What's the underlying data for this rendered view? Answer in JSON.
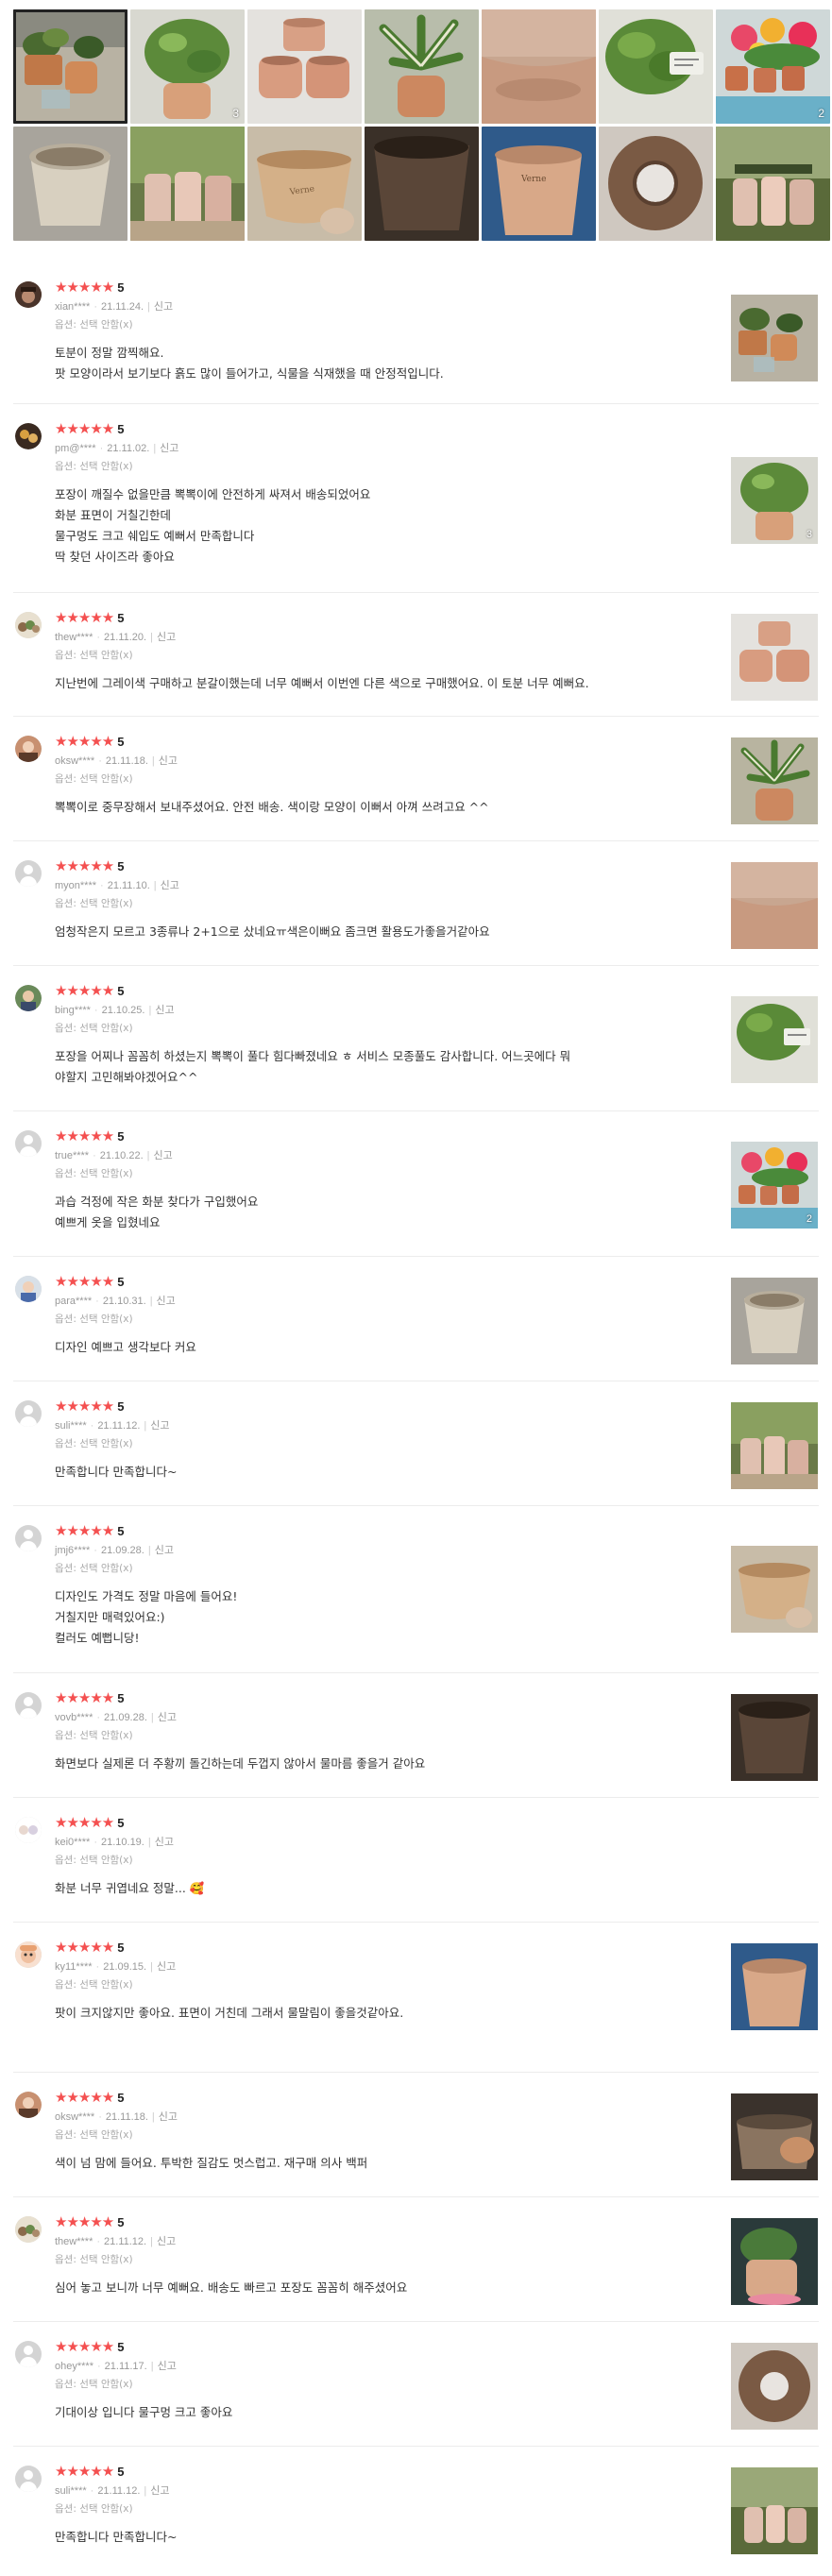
{
  "gallery": {
    "thumbs": [
      {
        "name": "gallery-photo-plants-pots",
        "count": ""
      },
      {
        "name": "gallery-photo-plant-closeup",
        "count": "3"
      },
      {
        "name": "gallery-photo-stacked-pots",
        "count": ""
      },
      {
        "name": "gallery-photo-striped-plant",
        "count": ""
      },
      {
        "name": "gallery-photo-pot-shapes",
        "count": ""
      },
      {
        "name": "gallery-photo-green-plant",
        "count": ""
      },
      {
        "name": "gallery-photo-flowers-shelf",
        "count": "2"
      },
      {
        "name": "gallery-photo-white-pot",
        "count": ""
      },
      {
        "name": "gallery-photo-pots-row",
        "count": ""
      },
      {
        "name": "gallery-photo-pot-in-hand",
        "count": ""
      },
      {
        "name": "gallery-photo-dark-pot",
        "count": ""
      },
      {
        "name": "gallery-photo-logo-pot",
        "count": ""
      },
      {
        "name": "gallery-photo-donut-pot",
        "count": ""
      },
      {
        "name": "gallery-photo-pots-window",
        "count": ""
      }
    ]
  },
  "reviews": [
    {
      "stars": "★★★★★",
      "score": "5",
      "user": "xian****",
      "date": "21.11.24.",
      "report": "신고",
      "option": "옵션: 선택 안함(x)",
      "lines": [
        "토분이 정말 깜찍해요.",
        "팟 모양이라서 보기보다 흙도 많이 들어가고, 식물을 식재했을 때 안정적입니다."
      ],
      "thumb_count": ""
    },
    {
      "stars": "★★★★★",
      "score": "5",
      "user": "pm@****",
      "date": "21.11.02.",
      "report": "신고",
      "option": "옵션: 선택 안함(x)",
      "lines": [
        "포장이 깨질수 없을만큼 뽁뽁이에 안전하게 싸져서 배송되었어요",
        "화분 표면이 거칠긴한데",
        "물구멍도 크고 쉐입도 예뻐서 만족합니다",
        "딱 찾던 사이즈라 좋아요"
      ],
      "thumb_count": "3"
    },
    {
      "stars": "★★★★★",
      "score": "5",
      "user": "thew****",
      "date": "21.11.20.",
      "report": "신고",
      "option": "옵션: 선택 안함(x)",
      "lines": [
        "지난번에 그레이색 구매하고 분갈이했는데 너무 예뻐서 이번엔 다른 색으로 구매했어요. 이 토분 너무 예뻐요."
      ],
      "thumb_count": ""
    },
    {
      "stars": "★★★★★",
      "score": "5",
      "user": "oksw****",
      "date": "21.11.18.",
      "report": "신고",
      "option": "옵션: 선택 안함(x)",
      "lines": [
        "뽁뽁이로 중무장해서 보내주셨어요. 안전 배송. 색이랑 모양이 이뻐서 아껴 쓰려고요 ^^"
      ],
      "thumb_count": ""
    },
    {
      "stars": "★★★★★",
      "score": "5",
      "user": "myon****",
      "date": "21.11.10.",
      "report": "신고",
      "option": "옵션: 선택 안함(x)",
      "lines": [
        "엄청작은지 모르고 3종류나 2+1으로 샀네요ㅠ색은이뻐요 좀크면 활용도가좋을거같아요"
      ],
      "thumb_count": ""
    },
    {
      "stars": "★★★★★",
      "score": "5",
      "user": "bing****",
      "date": "21.10.25.",
      "report": "신고",
      "option": "옵션: 선택 안함(x)",
      "lines": [
        "포장을 어찌나  꼼꼼히 하셨는지 뽁뽁이 풀다 힘다빠졌네요 ㅎ 서비스  모종풀도 감사합니다.  어느곳에다 뭐",
        "야할지  고민해봐야겠어요^^"
      ],
      "thumb_count": ""
    },
    {
      "stars": "★★★★★",
      "score": "5",
      "user": "true****",
      "date": "21.10.22.",
      "report": "신고",
      "option": "옵션: 선택 안함(x)",
      "lines": [
        "과습 걱정에 작은 화분 찾다가 구입했어요",
        "예쁘게 옷을 입혔네요"
      ],
      "thumb_count": "2"
    },
    {
      "stars": "★★★★★",
      "score": "5",
      "user": "para****",
      "date": "21.10.31.",
      "report": "신고",
      "option": "옵션: 선택 안함(x)",
      "lines": [
        "디자인 예쁘고 생각보다 커요"
      ],
      "thumb_count": ""
    },
    {
      "stars": "★★★★★",
      "score": "5",
      "user": "suli****",
      "date": "21.11.12.",
      "report": "신고",
      "option": "옵션: 선택 안함(x)",
      "lines": [
        "만족합니다 만족합니다~"
      ],
      "thumb_count": ""
    },
    {
      "stars": "★★★★★",
      "score": "5",
      "user": "jmj6****",
      "date": "21.09.28.",
      "report": "신고",
      "option": "옵션: 선택 안함(x)",
      "lines": [
        "디자인도 가격도 정말 마음에 들어요!",
        "거칠지만 매력있어요:)",
        "컬러도 예뻡니당!"
      ],
      "thumb_count": ""
    },
    {
      "stars": "★★★★★",
      "score": "5",
      "user": "vovb****",
      "date": "21.09.28.",
      "report": "신고",
      "option": "옵션: 선택 안함(x)",
      "lines": [
        "화면보다 실제론 더 주황끼 돌긴하는데 두껍지 않아서 물마름 좋을거 같아요"
      ],
      "thumb_count": ""
    },
    {
      "stars": "★★★★★",
      "score": "5",
      "user": "kei0****",
      "date": "21.10.19.",
      "report": "신고",
      "option": "옵션: 선택 안함(x)",
      "lines": [
        "화분 너무 귀엽네요 정말... 🥰"
      ],
      "thumb_count": ""
    },
    {
      "stars": "★★★★★",
      "score": "5",
      "user": "ky11****",
      "date": "21.09.15.",
      "report": "신고",
      "option": "옵션: 선택 안함(x)",
      "lines": [
        "팟이 크지않지만 좋아요. 표면이 거친데 그래서 물말림이 좋을것같아요."
      ],
      "thumb_count": ""
    },
    {
      "stars": "★★★★★",
      "score": "5",
      "user": "oksw****",
      "date": "21.11.18.",
      "report": "신고",
      "option": "옵션: 선택 안함(x)",
      "lines": [
        "색이 넘 맘에 들어요. 투박한 질감도 멋스럽고. 재구매 의사 백퍼"
      ],
      "thumb_count": ""
    },
    {
      "stars": "★★★★★",
      "score": "5",
      "user": "thew****",
      "date": "21.11.12.",
      "report": "신고",
      "option": "옵션: 선택 안함(x)",
      "lines": [
        "심어 놓고 보니까 너무 예뻐요.   배송도 빠르고 포장도 꼼꼼히 해주셨어요"
      ],
      "thumb_count": ""
    },
    {
      "stars": "★★★★★",
      "score": "5",
      "user": "ohey****",
      "date": "21.11.17.",
      "report": "신고",
      "option": "옵션: 선택 안함(x)",
      "lines": [
        "기대이상 입니다 물구멍 크고 좋아요"
      ],
      "thumb_count": ""
    },
    {
      "stars": "★★★★★",
      "score": "5",
      "user": "suli****",
      "date": "21.11.12.",
      "report": "신고",
      "option": "옵션: 선택 안함(x)",
      "lines": [
        "만족합니다 만족합니다~"
      ],
      "thumb_count": ""
    }
  ]
}
